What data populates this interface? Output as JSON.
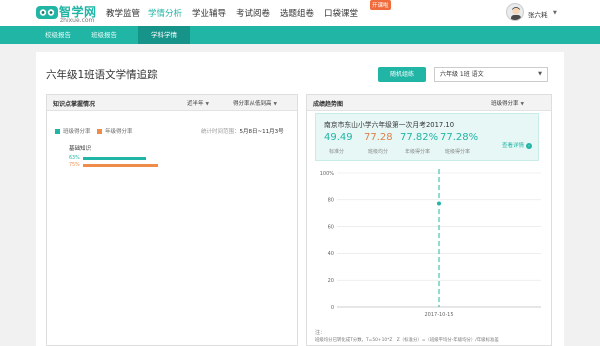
{
  "brand": {
    "name": "智学网",
    "domain": "zhixue.com",
    "color": "#21b5a6"
  },
  "nav": {
    "items": [
      {
        "label": "教学监管",
        "active": false
      },
      {
        "label": "学情分析",
        "active": true
      },
      {
        "label": "学业辅导",
        "active": false
      },
      {
        "label": "考试阅卷",
        "active": false
      },
      {
        "label": "选题组卷",
        "active": false
      },
      {
        "label": "口袋课堂",
        "active": false
      }
    ],
    "badge": "开课啦"
  },
  "user": {
    "name": "张六耗",
    "avatar_icon": "user-avatar-icon"
  },
  "subnav": {
    "tabs": [
      {
        "label": "校级报告",
        "active": false
      },
      {
        "label": "班级报告",
        "active": false
      },
      {
        "label": "学科学情",
        "active": true
      }
    ]
  },
  "page": {
    "title": "六年级1班语文学情追踪",
    "practice_button": "随机组练",
    "class_select": "六年级 1班 语文"
  },
  "knowledge_panel": {
    "title": "知识点掌握情况",
    "period_select": "近半年",
    "sort_select": "得分率从低到高",
    "legend": [
      {
        "label": "班级得分率",
        "color": "#21b5a6"
      },
      {
        "label": "年级得分率",
        "color": "#f08c4a"
      }
    ],
    "range_label": "统计时间范围：",
    "range_value": "5月8日~11月3号",
    "items": [
      {
        "name": "基础知识",
        "class_rate": "63%",
        "grade_rate": "75%",
        "class_value": 63,
        "grade_value": 75
      }
    ]
  },
  "trend_panel": {
    "title": "成绩趋势图",
    "metric_select": "班级得分率",
    "exam": {
      "name": "南京市东山小学六年级第一次月考2017.10",
      "stats": [
        {
          "value": "49.49",
          "label": "标准分",
          "color": "#21b5a6"
        },
        {
          "value": "77.28",
          "label": "班级均分",
          "color": "#e08048"
        },
        {
          "value": "77.82%",
          "label": "年级得分率",
          "color": "#21b5a6"
        },
        {
          "value": "77.28%",
          "label": "班级得分率",
          "color": "#21b5a6"
        }
      ],
      "detail_link": "查看详情"
    },
    "chart_data": {
      "type": "line",
      "x": [
        "2017-10-15"
      ],
      "series": [
        {
          "values": [
            77.28
          ]
        }
      ],
      "ylim": [
        0,
        100
      ],
      "yticks": [
        "0",
        "20",
        "40",
        "60",
        "80",
        "100%"
      ],
      "grid": true
    },
    "note_title": "注：",
    "note_text": "班级均分已转化成T分数，T=50+10*Z　Z（标准分）=（班级平均分-年级均分）/年级标准差"
  }
}
